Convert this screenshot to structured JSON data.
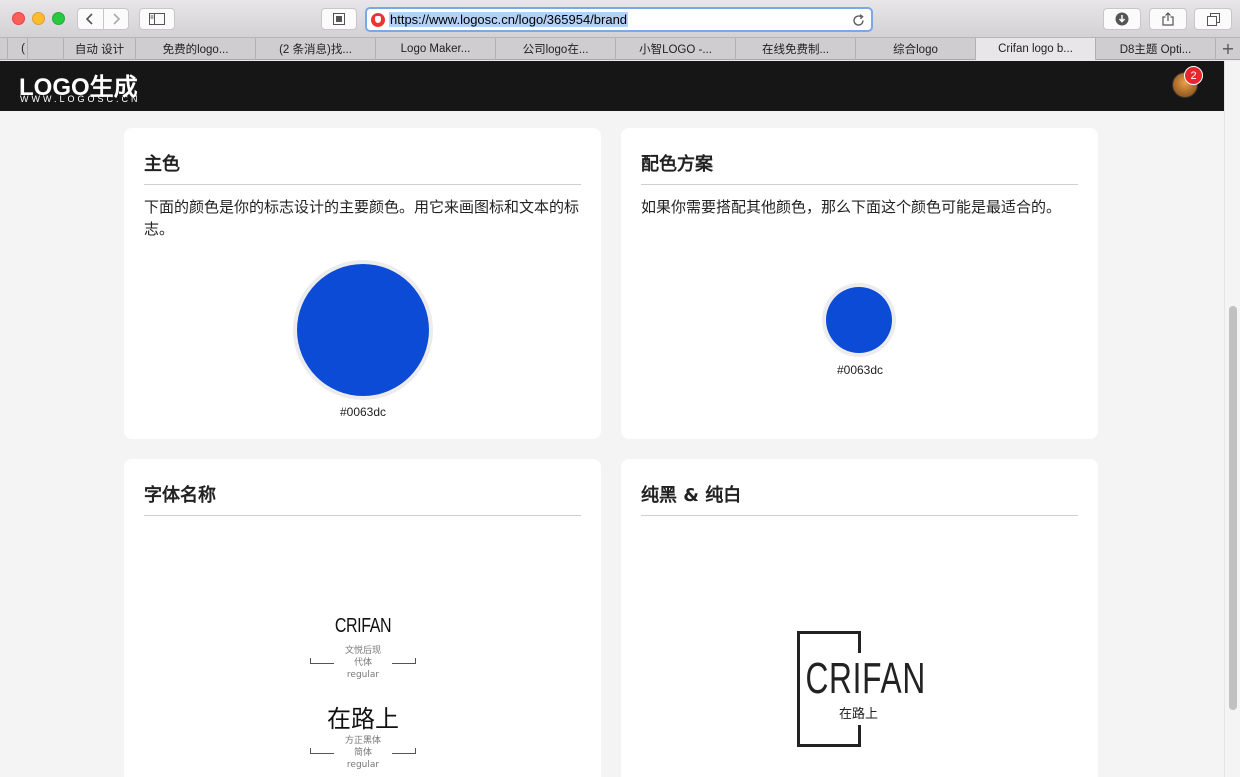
{
  "browser": {
    "url": "https://www.logosc.cn/logo/365954/brand",
    "tabs": [
      {
        "label": "",
        "active": false
      },
      {
        "label": "(",
        "active": false
      },
      {
        "label": "自动 设计",
        "active": false
      },
      {
        "label": "免费的logo...",
        "active": false
      },
      {
        "label": "(2 条消息)找...",
        "active": false
      },
      {
        "label": "Logo Maker...",
        "active": false
      },
      {
        "label": "公司logo在...",
        "active": false
      },
      {
        "label": "小智LOGO -...",
        "active": false
      },
      {
        "label": "在线免费制...",
        "active": false
      },
      {
        "label": "综合logo",
        "active": false
      },
      {
        "label": "Crifan logo b...",
        "active": true
      },
      {
        "label": "D8主题 Opti...",
        "active": false
      }
    ],
    "add_tab": "+"
  },
  "site": {
    "logo_main": "LOGO生成",
    "logo_sub": "WWW.LOGOSC.CN",
    "notification_count": "2"
  },
  "primary_color": {
    "title": "主色",
    "description": "下面的颜色是你的标志设计的主要颜色。用它来画图标和文本的标志。",
    "swatch_hex": "#0063dc"
  },
  "color_scheme": {
    "title": "配色方案",
    "description": "如果你需要搭配其他颜色，那么下面这个颜色可能是最适合的。",
    "swatch_hex": "#0063dc"
  },
  "fonts": {
    "title": "字体名称",
    "font1": {
      "sample": "CRIFAN",
      "name": "文悦后现代体",
      "name_line1": "文悦后现",
      "name_line2": "代体",
      "style": "regular"
    },
    "font2": {
      "sample": "在路上",
      "name_line1": "方正黑体",
      "name_line2": "简体",
      "style": "regular"
    }
  },
  "black_white": {
    "title": "纯黑 & 纯白",
    "logo_en": "CRIFAN",
    "logo_zh": "在路上"
  },
  "colors": {
    "swatch_fill": "#0b4bd6",
    "header_bg": "#161616",
    "badge": "#e8262b"
  }
}
